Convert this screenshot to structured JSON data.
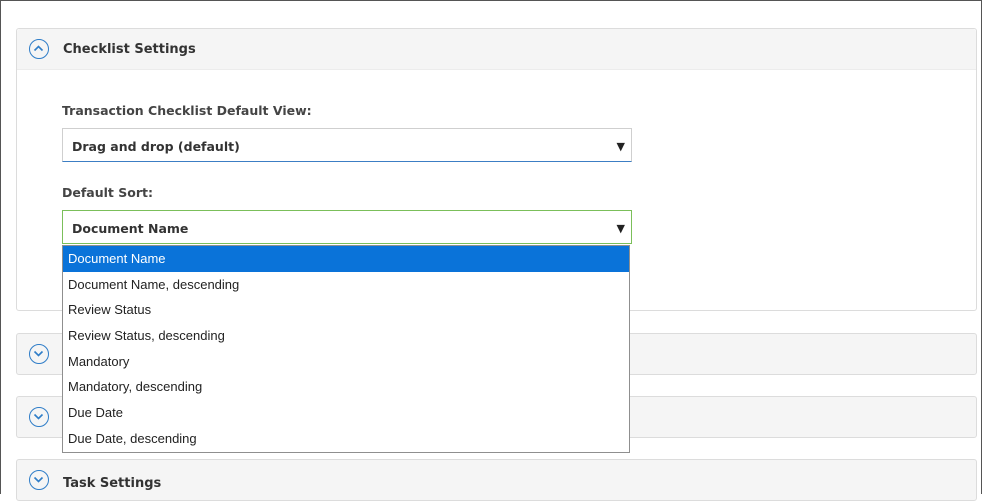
{
  "checklist_panel": {
    "title": "Checklist Settings",
    "default_view_label": "Transaction Checklist Default View:",
    "default_view_value": "Drag and drop (default)",
    "default_sort_label": "Default Sort:",
    "default_sort_value": "Document Name"
  },
  "sort_options": [
    {
      "label": "Document Name",
      "selected": true
    },
    {
      "label": "Document Name, descending",
      "selected": false
    },
    {
      "label": "Review Status",
      "selected": false
    },
    {
      "label": "Review Status, descending",
      "selected": false
    },
    {
      "label": "Mandatory",
      "selected": false
    },
    {
      "label": "Mandatory, descending",
      "selected": false
    },
    {
      "label": "Due Date",
      "selected": false
    },
    {
      "label": "Due Date, descending",
      "selected": false
    }
  ],
  "task_panel": {
    "title": "Task Settings"
  },
  "icons": {
    "expanded": "chevron-up-circle-icon",
    "collapsed": "chevron-down-circle-icon"
  },
  "colors": {
    "accent": "#2f7dc8",
    "selected_option": "#0a73d9",
    "focus_border": "#7bbf5a"
  }
}
